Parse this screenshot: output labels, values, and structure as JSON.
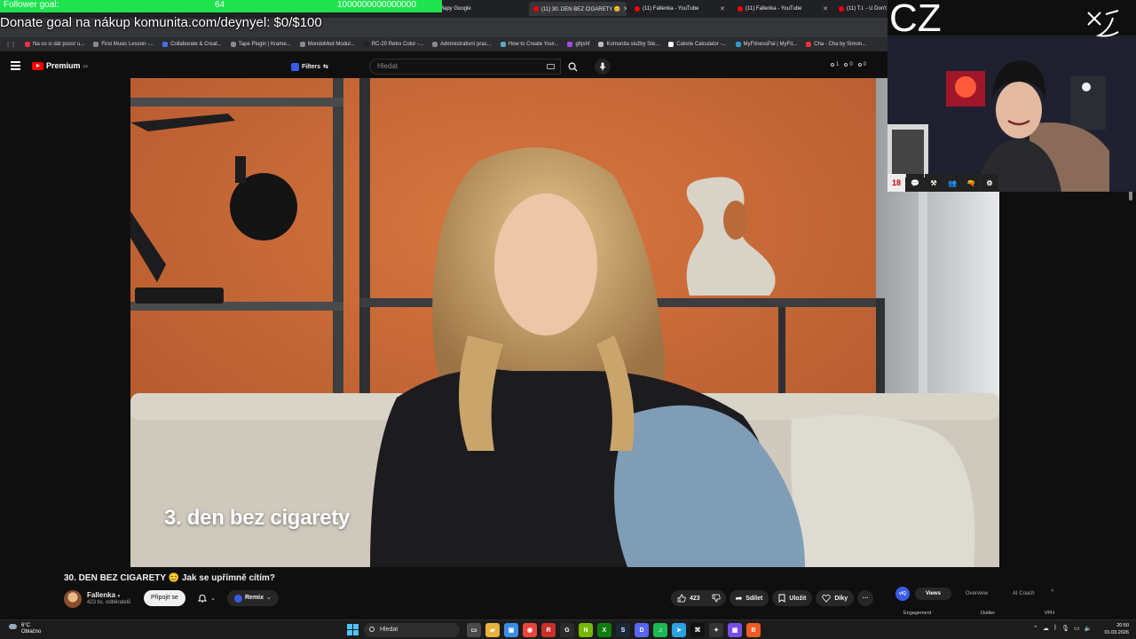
{
  "stream_overlay": {
    "follower_goal_label": "Follower goal:",
    "follower_goal_count": "64",
    "follower_goal_target": "1000000000000000",
    "donate_goal": "Donate goal na nákup komunita.com/deynyel: $0/$100",
    "country_code": "CZ",
    "badges": [
      "18",
      "💬",
      "⚒",
      "👥",
      "🔫",
      "⚙"
    ]
  },
  "browser": {
    "tabs": [
      {
        "label": "Mapy Google",
        "active": false
      },
      {
        "label": "(11) 30. DEN BEZ CIGARETY 😊",
        "active": true
      },
      {
        "label": "(11) Fallenka - YouTube",
        "active": false
      },
      {
        "label": "(11) Fallenka - YouTube",
        "active": false
      },
      {
        "label": "(11) T.I. - U Don't",
        "active": false
      }
    ],
    "bookmarks": [
      "Na co si dát pozor u...",
      "First Music Lesson -...",
      "Collaborate & Creat...",
      "Tape Plugin | Krame...",
      "MondoMod Modul...",
      "RC-20 Retro Color -...",
      "Administrativní prac...",
      "How to Create Your...",
      "ghjshf",
      "Komunita služby Ste...",
      "Calorie Calculator -...",
      "MyFitnessPal | MyFit...",
      "Cha - Cha by Simon..."
    ]
  },
  "youtube": {
    "logo_text": "Premium",
    "region": "CZ",
    "filters_label": "Filters",
    "search_placeholder": "Hledat",
    "header_stats": [
      "1",
      "0",
      "0"
    ],
    "video_caption": "3. den bez cigarety",
    "video_title": "30. DEN BEZ CIGARETY 😊 Jak se upřímně cítím?",
    "channel_name": "Fallenka",
    "channel_verified": "●",
    "subscribers": "423 tis. odběratelů",
    "join_label": "Připojit se",
    "remix_label": "Remix",
    "likes": "423",
    "share_label": "Sdílet",
    "save_label": "Uložit",
    "thanks_label": "Díky",
    "more_label": "···"
  },
  "vidiq": {
    "logo": "vIQ",
    "tabs": [
      {
        "label": "Views",
        "active": true
      },
      {
        "label": "Overview",
        "active": false
      },
      {
        "label": "AI Coach",
        "active": false
      }
    ],
    "columns": [
      "Engagement",
      "Outlier",
      "VPH"
    ]
  },
  "taskbar": {
    "weather_temp": "6°C",
    "weather_desc": "Oblačno",
    "search_placeholder": "Hledat",
    "apps": [
      {
        "glyph": "▭",
        "color": "#4a4a4a"
      },
      {
        "glyph": "▰",
        "color": "#e8b33c"
      },
      {
        "glyph": "▣",
        "color": "#3a8ee6"
      },
      {
        "glyph": "◉",
        "color": "#e8453c"
      },
      {
        "glyph": "R",
        "color": "#c8322a"
      },
      {
        "glyph": "G",
        "color": "#2b2b2b"
      },
      {
        "glyph": "N",
        "color": "#76b900"
      },
      {
        "glyph": "X",
        "color": "#107c10"
      },
      {
        "glyph": "S",
        "color": "#1b2838"
      },
      {
        "glyph": "D",
        "color": "#5865f2"
      },
      {
        "glyph": "♫",
        "color": "#1db954"
      },
      {
        "glyph": "➤",
        "color": "#2aa3e0"
      },
      {
        "glyph": "⌘",
        "color": "#111111"
      },
      {
        "glyph": "✦",
        "color": "#333333"
      },
      {
        "glyph": "▦",
        "color": "#7b4de6"
      },
      {
        "glyph": "B",
        "color": "#f15a24"
      }
    ],
    "clock_time": "20:50",
    "clock_date": "01.03.2026"
  },
  "colors": {
    "youtube_red": "#ff0000",
    "follower_bar": "#1ee34f",
    "video_wall": "#c4632e",
    "vidiq_blue": "#3a5ce6"
  }
}
